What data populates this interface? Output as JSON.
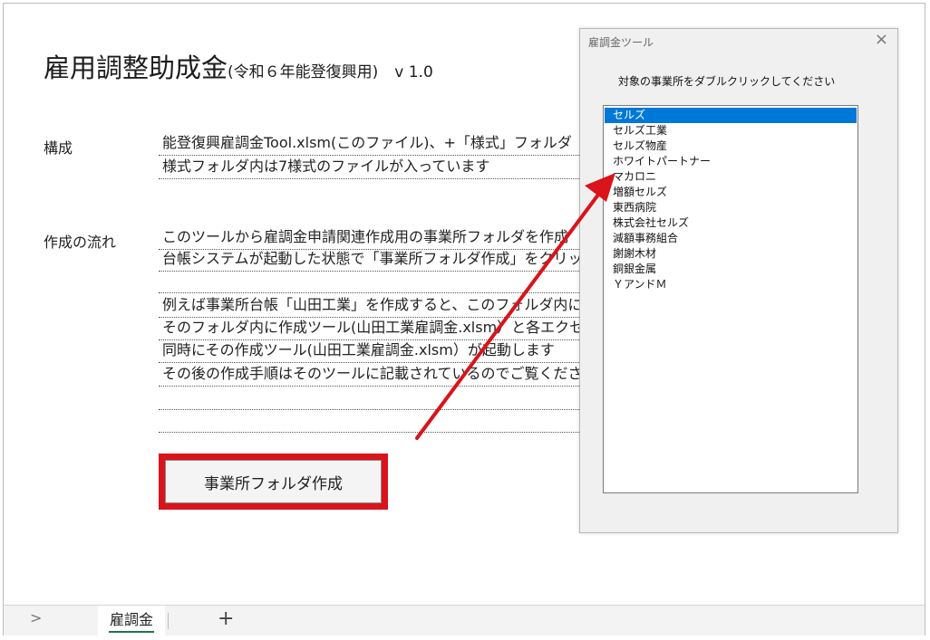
{
  "sheet": {
    "title_main": "雇用調整助成金",
    "title_sub": "(令和６年能登復興用)",
    "version": "v 1.0",
    "sections": [
      {
        "label": "構成",
        "lines": [
          "能登復興雇調金Tool.xlsm(このファイル)、+「様式」フォルダ",
          "様式フォルダ内は7様式のファイルが入っています"
        ]
      },
      {
        "label": "作成の流れ",
        "lines": [
          "このツールから雇調金申請関連作成用の事業所フォルダを作成",
          "台帳システムが起動した状態で「事業所フォルダ作成」をクリック",
          "",
          "例えば事業所台帳「山田工業」を作成すると、このフォルダ内にフ",
          "そのフォルダ内に作成ツール(山田工業雇調金.xlsm）と各エクセ",
          "同時にその作成ツール(山田工業雇調金.xlsm）が起動します",
          "その後の作成手順はそのツールに記載されているのでご覧ください",
          "",
          ""
        ]
      }
    ],
    "action_button": "事業所フォルダ作成"
  },
  "dialog": {
    "title": "雇調金ツール",
    "close": "×",
    "prompt": "対象の事業所をダブルクリックしてください",
    "items": [
      "セルズ",
      "セルズ工業",
      "セルズ物産",
      "ホワイトパートナー",
      "マカロニ",
      "増額セルズ",
      "東西病院",
      "株式会社セルズ",
      "減額事務組合",
      "謝謝木材",
      "銅銀金属",
      "ＹアンドＭ"
    ],
    "selected_index": 0
  },
  "tabbar": {
    "nav": ">",
    "active_sheet": "雇調金",
    "add": "+"
  },
  "colors": {
    "highlight_red": "#d9141a",
    "selection_blue": "#0078d7",
    "tab_underline": "#217346"
  }
}
